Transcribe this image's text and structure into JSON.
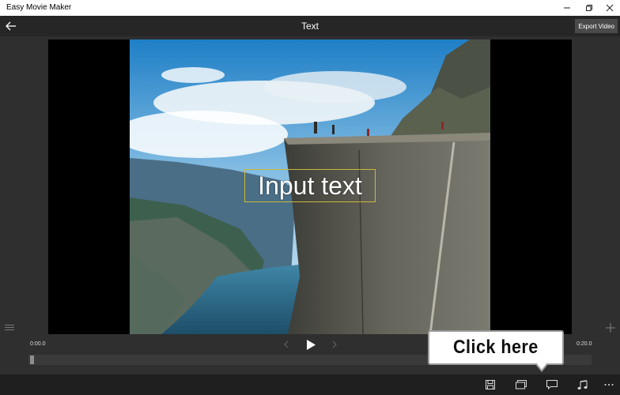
{
  "window": {
    "title": "Easy Movie Maker",
    "minimize_icon": "minimize-icon",
    "restore_icon": "restore-icon",
    "close_icon": "close-icon"
  },
  "header": {
    "title": "Text",
    "back_icon": "back-arrow-icon",
    "export_label": "Export Video"
  },
  "preview": {
    "overlay_text": "Input text"
  },
  "playback": {
    "start_time": "0:00.0",
    "end_time": "0:20.0",
    "prev_icon": "chevron-left-icon",
    "play_icon": "play-icon",
    "next_icon": "chevron-right-icon",
    "position": 0.0
  },
  "side": {
    "list_icon": "list-icon",
    "add_icon": "plus-icon"
  },
  "toolbar": {
    "save_icon": "save-icon",
    "media_icon": "media-icon",
    "text_icon": "speech-bubble-icon",
    "music_icon": "music-note-icon",
    "more_icon": "more-icon"
  },
  "callout": {
    "text": "Click here"
  },
  "colors": {
    "background": "#2b2b2b",
    "header": "#262626",
    "bottombar": "#1f1f1f",
    "text_box_border": "#c9b93a"
  }
}
